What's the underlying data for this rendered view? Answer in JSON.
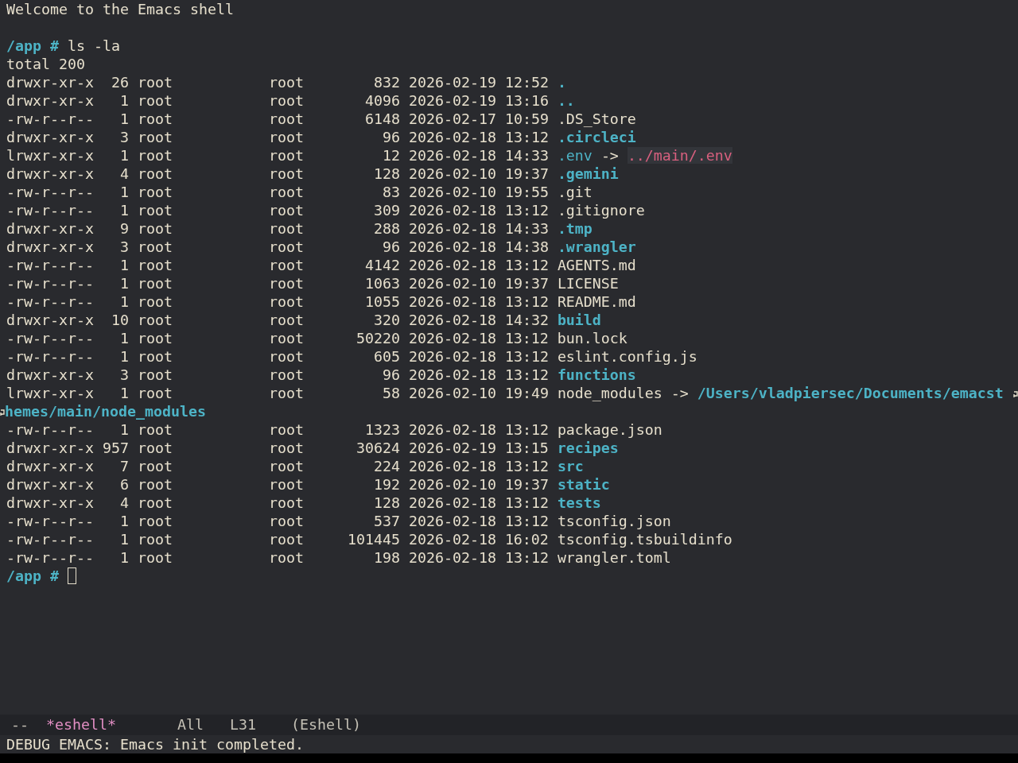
{
  "welcome": "Welcome to the Emacs shell",
  "command": {
    "prompt": "/app #",
    "text": "ls -la"
  },
  "total": "total 200",
  "entries": [
    {
      "perms": "drwxr-xr-x",
      "links": "26",
      "owner": "root",
      "group": "root",
      "size": "832",
      "date": "2026-02-19",
      "time": "12:52",
      "name": ".",
      "kind": "dir"
    },
    {
      "perms": "drwxr-xr-x",
      "links": "1",
      "owner": "root",
      "group": "root",
      "size": "4096",
      "date": "2026-02-19",
      "time": "13:16",
      "name": "..",
      "kind": "dir"
    },
    {
      "perms": "-rw-r--r--",
      "links": "1",
      "owner": "root",
      "group": "root",
      "size": "6148",
      "date": "2026-02-17",
      "time": "10:59",
      "name": ".DS_Store",
      "kind": "file"
    },
    {
      "perms": "drwxr-xr-x",
      "links": "3",
      "owner": "root",
      "group": "root",
      "size": "96",
      "date": "2026-02-18",
      "time": "13:12",
      "name": ".circleci",
      "kind": "dir"
    },
    {
      "perms": "lrwxr-xr-x",
      "links": "1",
      "owner": "root",
      "group": "root",
      "size": "12",
      "date": "2026-02-18",
      "time": "14:33",
      "name": ".env",
      "kind": "link",
      "arrow": "->",
      "target": "../main/.env",
      "target_broken": true
    },
    {
      "perms": "drwxr-xr-x",
      "links": "4",
      "owner": "root",
      "group": "root",
      "size": "128",
      "date": "2026-02-10",
      "time": "19:37",
      "name": ".gemini",
      "kind": "dir"
    },
    {
      "perms": "-rw-r--r--",
      "links": "1",
      "owner": "root",
      "group": "root",
      "size": "83",
      "date": "2026-02-10",
      "time": "19:55",
      "name": ".git",
      "kind": "file"
    },
    {
      "perms": "-rw-r--r--",
      "links": "1",
      "owner": "root",
      "group": "root",
      "size": "309",
      "date": "2026-02-18",
      "time": "13:12",
      "name": ".gitignore",
      "kind": "file"
    },
    {
      "perms": "drwxr-xr-x",
      "links": "9",
      "owner": "root",
      "group": "root",
      "size": "288",
      "date": "2026-02-18",
      "time": "14:33",
      "name": ".tmp",
      "kind": "dir"
    },
    {
      "perms": "drwxr-xr-x",
      "links": "3",
      "owner": "root",
      "group": "root",
      "size": "96",
      "date": "2026-02-18",
      "time": "14:38",
      "name": ".wrangler",
      "kind": "dir"
    },
    {
      "perms": "-rw-r--r--",
      "links": "1",
      "owner": "root",
      "group": "root",
      "size": "4142",
      "date": "2026-02-18",
      "time": "13:12",
      "name": "AGENTS.md",
      "kind": "file"
    },
    {
      "perms": "-rw-r--r--",
      "links": "1",
      "owner": "root",
      "group": "root",
      "size": "1063",
      "date": "2026-02-10",
      "time": "19:37",
      "name": "LICENSE",
      "kind": "file"
    },
    {
      "perms": "-rw-r--r--",
      "links": "1",
      "owner": "root",
      "group": "root",
      "size": "1055",
      "date": "2026-02-18",
      "time": "13:12",
      "name": "README.md",
      "kind": "file"
    },
    {
      "perms": "drwxr-xr-x",
      "links": "10",
      "owner": "root",
      "group": "root",
      "size": "320",
      "date": "2026-02-18",
      "time": "14:32",
      "name": "build",
      "kind": "dir"
    },
    {
      "perms": "-rw-r--r--",
      "links": "1",
      "owner": "root",
      "group": "root",
      "size": "50220",
      "date": "2026-02-18",
      "time": "13:12",
      "name": "bun.lock",
      "kind": "file"
    },
    {
      "perms": "-rw-r--r--",
      "links": "1",
      "owner": "root",
      "group": "root",
      "size": "605",
      "date": "2026-02-18",
      "time": "13:12",
      "name": "eslint.config.js",
      "kind": "file"
    },
    {
      "perms": "drwxr-xr-x",
      "links": "3",
      "owner": "root",
      "group": "root",
      "size": "96",
      "date": "2026-02-18",
      "time": "13:12",
      "name": "functions",
      "kind": "dir"
    },
    {
      "perms": "lrwxr-xr-x",
      "links": "1",
      "owner": "root",
      "group": "root",
      "size": "58",
      "date": "2026-02-10",
      "time": "19:49",
      "name": "node_modules",
      "kind": "file",
      "arrow": "->",
      "target": "/Users/vladpiersec/Documents/emacst",
      "target_continued": "hemes/main/node_modules",
      "target_broken": false
    },
    {
      "perms": "-rw-r--r--",
      "links": "1",
      "owner": "root",
      "group": "root",
      "size": "1323",
      "date": "2026-02-18",
      "time": "13:12",
      "name": "package.json",
      "kind": "file"
    },
    {
      "perms": "drwxr-xr-x",
      "links": "957",
      "owner": "root",
      "group": "root",
      "size": "30624",
      "date": "2026-02-19",
      "time": "13:15",
      "name": "recipes",
      "kind": "dir"
    },
    {
      "perms": "drwxr-xr-x",
      "links": "7",
      "owner": "root",
      "group": "root",
      "size": "224",
      "date": "2026-02-18",
      "time": "13:12",
      "name": "src",
      "kind": "dir"
    },
    {
      "perms": "drwxr-xr-x",
      "links": "6",
      "owner": "root",
      "group": "root",
      "size": "192",
      "date": "2026-02-10",
      "time": "19:37",
      "name": "static",
      "kind": "dir"
    },
    {
      "perms": "drwxr-xr-x",
      "links": "4",
      "owner": "root",
      "group": "root",
      "size": "128",
      "date": "2026-02-18",
      "time": "13:12",
      "name": "tests",
      "kind": "dir"
    },
    {
      "perms": "-rw-r--r--",
      "links": "1",
      "owner": "root",
      "group": "root",
      "size": "537",
      "date": "2026-02-18",
      "time": "13:12",
      "name": "tsconfig.json",
      "kind": "file"
    },
    {
      "perms": "-rw-r--r--",
      "links": "1",
      "owner": "root",
      "group": "root",
      "size": "101445",
      "date": "2026-02-18",
      "time": "16:02",
      "name": "tsconfig.tsbuildinfo",
      "kind": "file"
    },
    {
      "perms": "-rw-r--r--",
      "links": "1",
      "owner": "root",
      "group": "root",
      "size": "198",
      "date": "2026-02-18",
      "time": "13:12",
      "name": "wrangler.toml",
      "kind": "file"
    }
  ],
  "final_prompt": {
    "prompt": "/app #"
  },
  "mode_line": {
    "status": "--",
    "buffer": "*eshell*",
    "position": "All",
    "line": "L31",
    "mode": "(Eshell)"
  },
  "echo_area": "DEBUG EMACS: Emacs init completed."
}
